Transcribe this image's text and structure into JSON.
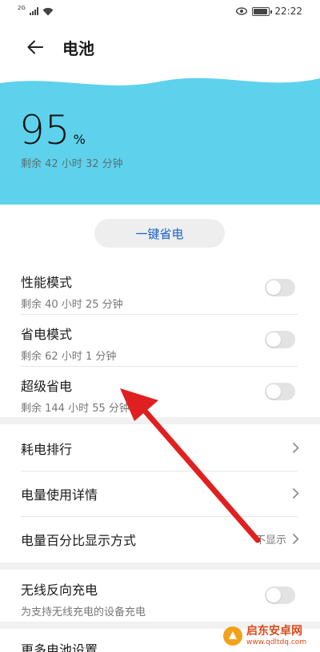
{
  "status_bar": {
    "network_tag": "2G",
    "time": "22:22"
  },
  "app_bar": {
    "title": "电池"
  },
  "battery": {
    "percent": "95",
    "unit": "%",
    "remaining": "剩余 42 小时 32 分钟",
    "panel_color": "#5ed2ec"
  },
  "one_key_save": {
    "label": "一键省电"
  },
  "modes": [
    {
      "title": "性能模式",
      "sub": "剩余 40 小时 25 分钟",
      "enabled": false
    },
    {
      "title": "省电模式",
      "sub": "剩余 62 小时 1 分钟",
      "enabled": false
    },
    {
      "title": "超级省电",
      "sub": "剩余 144 小时 55 分钟",
      "enabled": false
    }
  ],
  "nav_items": [
    {
      "label": "耗电排行"
    },
    {
      "label": "电量使用详情"
    },
    {
      "label": "电量百分比显示方式",
      "value": "不显示"
    }
  ],
  "wireless": {
    "title": "无线反向充电",
    "sub": "为支持无线充电的设备充电",
    "enabled": false
  },
  "more": {
    "label": "更多电池设置"
  },
  "watermark": {
    "name": "启东安卓网",
    "url": "www.qdltdq.com"
  },
  "colors": {
    "accent": "#1862c9",
    "annotation_arrow": "#e02020"
  }
}
